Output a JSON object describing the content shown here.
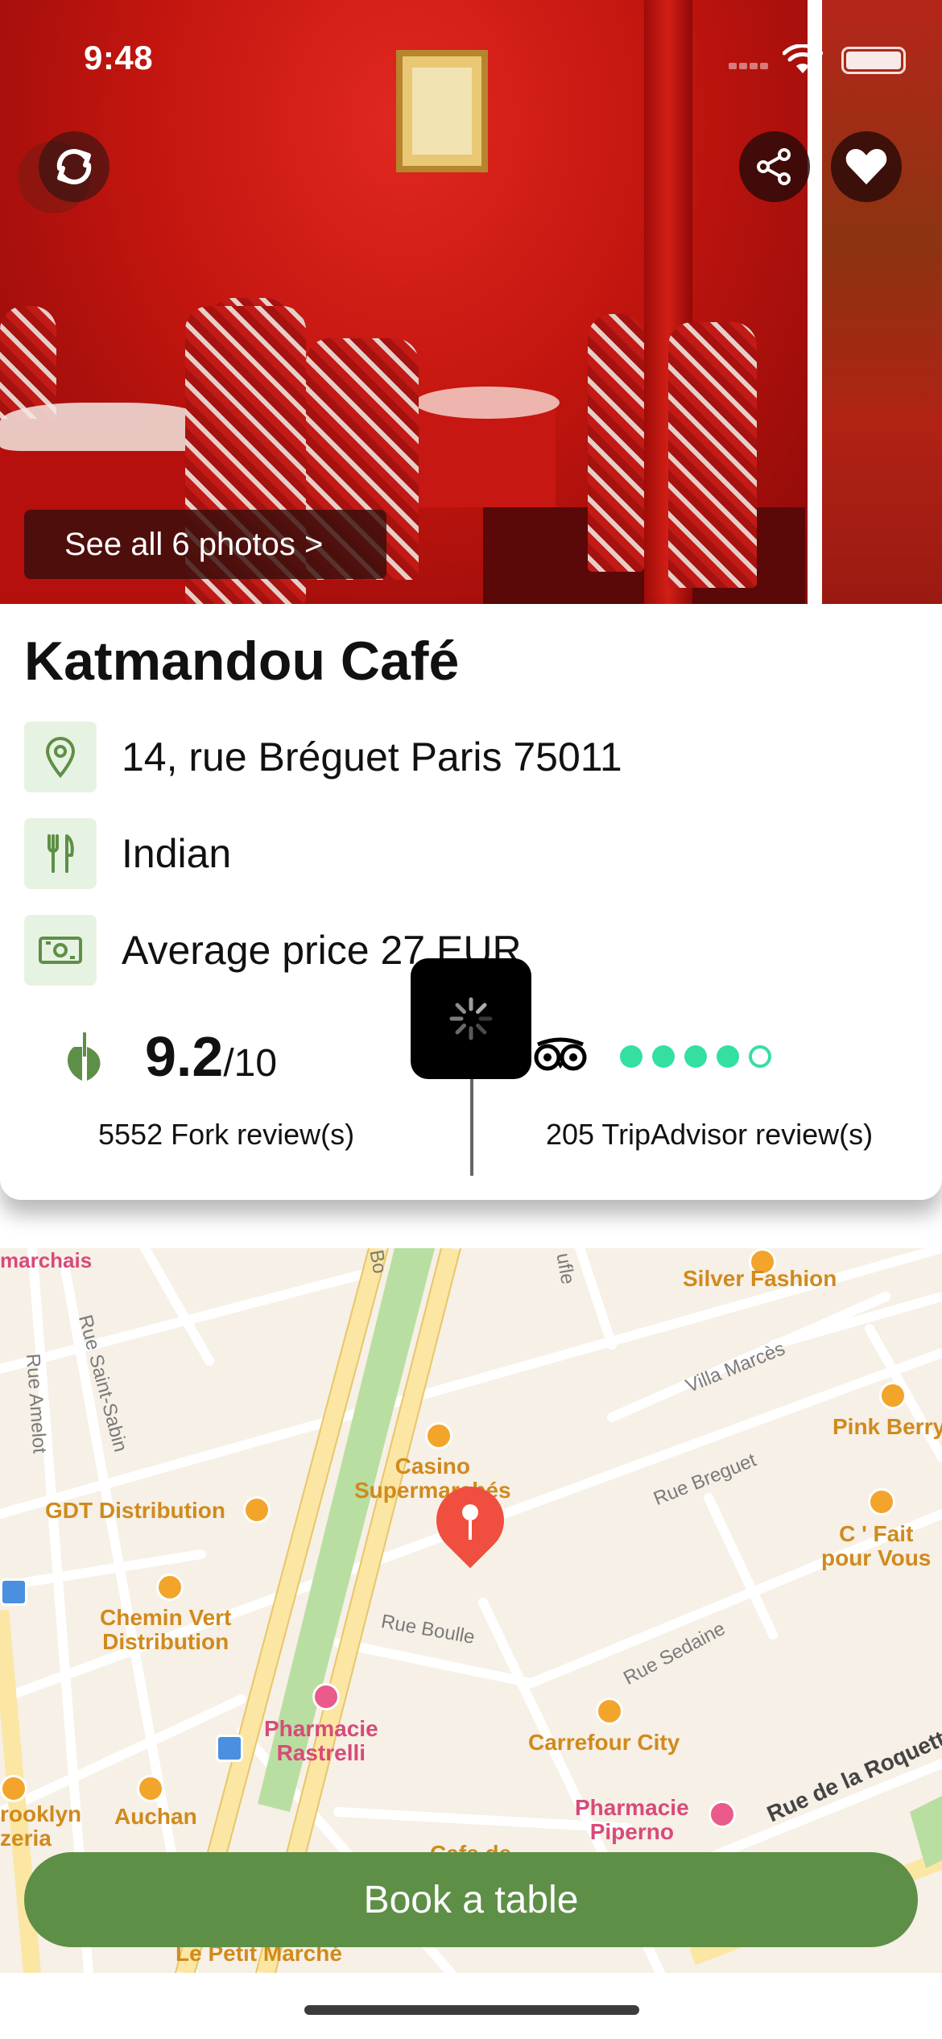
{
  "status_bar": {
    "time": "9:48"
  },
  "photos": {
    "see_all_label": "See all 6 photos >"
  },
  "restaurant": {
    "name": "Katmandou Café",
    "address": "14, rue Bréguet Paris 75011",
    "cuisine": "Indian",
    "price": "Average price 27 EUR"
  },
  "ratings": {
    "fork_score": "9.2",
    "fork_scale": "/10",
    "fork_reviews": "5552 Fork review(s)",
    "tripadvisor_bubbles": 4,
    "tripadvisor_max": 5,
    "tripadvisor_reviews": "205 TripAdvisor review(s)"
  },
  "map": {
    "labels": {
      "silver_fashion": "Silver Fashion",
      "pink_berry": "Pink Berry",
      "casino": "Casino\nSupermarchés",
      "gdt": "GDT Distribution",
      "cfait": "C ' Fait\npour Vous",
      "chemin": "Chemin Vert\nDistribution",
      "pharmacie_rastrelli": "Pharmacie\nRastrelli",
      "carrefour": "Carrefour City",
      "pharmacie_piperno": "Pharmacie\nPiperno",
      "auchan": "Auchan",
      "brooklyn": "rooklyn\nzeria",
      "petit_marche": "Le Petit Marché",
      "cafe": "Cafe de",
      "marchais": "marchais"
    },
    "streets": {
      "amelot": "Rue Amelot",
      "saint_sabin": "Rue Saint-Sabin",
      "villa_marces": "Villa Marcès",
      "rue_breguet": "Rue Breguet",
      "rue_boulle": "Rue Boulle",
      "rue_sedaine": "Rue Sedaine",
      "roquette": "Rue de la Roquette",
      "bd": "Bo",
      "rue_ufle": "ufle"
    }
  },
  "cta": {
    "book_label": "Book a table"
  },
  "colors": {
    "brand_green": "#5e8f47",
    "tripadvisor_green": "#34e0a1",
    "pin_red": "#f04e3e"
  }
}
